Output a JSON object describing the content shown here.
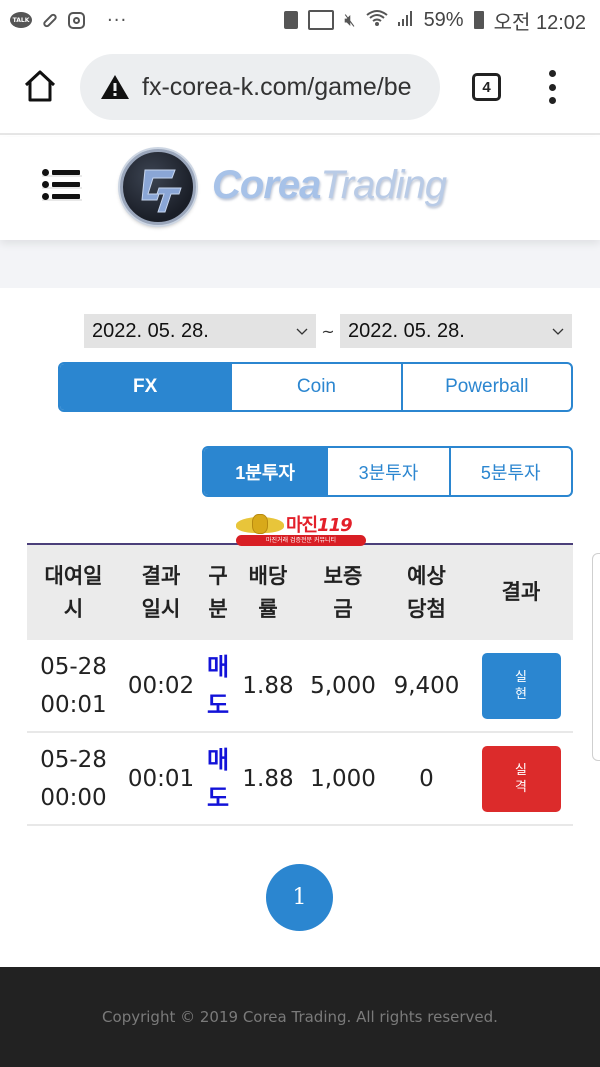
{
  "status_bar": {
    "left_icons": [
      "kakaotalk-icon",
      "pill-icon",
      "instagram-icon",
      "more-notifications-icon"
    ],
    "right_icons": [
      "battery-saver-icon",
      "cast-icon",
      "mute-icon",
      "wifi-icon",
      "signal-icon"
    ],
    "talk_label": "TALK",
    "more_label": "···",
    "battery_percent": "59%",
    "time": "오전 12:02"
  },
  "browser": {
    "url": "fx-corea-k.com/game/be",
    "tab_count": "4"
  },
  "site": {
    "brand_first": "Corea",
    "brand_second": "Trading"
  },
  "filters": {
    "date_from": "2022. 05. 28.",
    "date_to": "2022. 05. 28.",
    "date_separator": "~",
    "markets": [
      {
        "label": "FX",
        "active": true
      },
      {
        "label": "Coin",
        "active": false
      },
      {
        "label": "Powerball",
        "active": false
      }
    ],
    "periods": [
      {
        "label": "1분투자",
        "active": true
      },
      {
        "label": "3분투자",
        "active": false
      },
      {
        "label": "5분투자",
        "active": false
      }
    ]
  },
  "banner": {
    "title": "마진",
    "number": "119",
    "subtitle": "마진거래 검증전문 커뮤니티"
  },
  "table": {
    "headers": [
      [
        "대여일",
        "시"
      ],
      [
        "결과",
        "일시"
      ],
      [
        "구",
        "분"
      ],
      [
        "배당",
        "률"
      ],
      [
        "보증",
        "금"
      ],
      [
        "예상",
        "당첨"
      ],
      [
        "결과",
        ""
      ]
    ],
    "rows": [
      {
        "rent_date": "05-28",
        "rent_time": "00:01",
        "result_time": "00:02",
        "side_1": "매",
        "side_2": "도",
        "odds": "1.88",
        "deposit": "5,000",
        "expected": "9,400",
        "result": "실현",
        "result_status": "win"
      },
      {
        "rent_date": "05-28",
        "rent_time": "00:00",
        "result_time": "00:01",
        "side_1": "매",
        "side_2": "도",
        "odds": "1.88",
        "deposit": "1,000",
        "expected": "0",
        "result": "실격",
        "result_status": "lose"
      }
    ]
  },
  "pagination": {
    "current_page": "1"
  },
  "footer": {
    "copyright": "Copyright © 2019 Corea Trading. All rights reserved."
  },
  "colors": {
    "accent_blue": "#2b86d0",
    "loss_red": "#dc2b2b",
    "side_blue": "#1212d8",
    "footer_bg": "#222222"
  }
}
